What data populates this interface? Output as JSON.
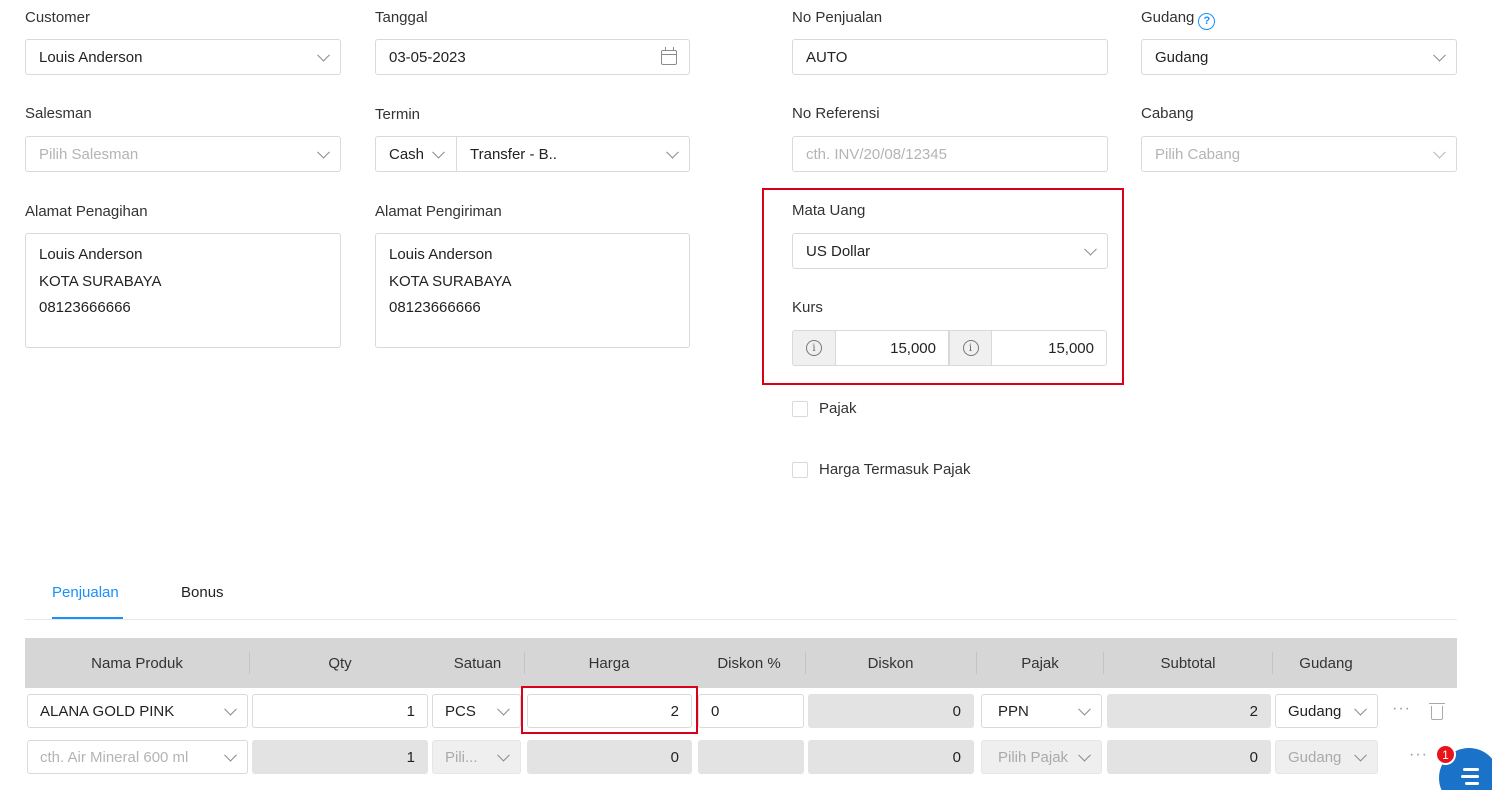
{
  "form": {
    "customer": {
      "label": "Customer",
      "value": "Louis Anderson"
    },
    "tanggal": {
      "label": "Tanggal",
      "value": "03-05-2023"
    },
    "no_penjualan": {
      "label": "No Penjualan",
      "value": "AUTO"
    },
    "gudang": {
      "label": "Gudang",
      "value": "Gudang"
    },
    "salesman": {
      "label": "Salesman",
      "placeholder": "Pilih Salesman"
    },
    "termin": {
      "label": "Termin",
      "type_value": "Cash",
      "method_value": "Transfer - B.."
    },
    "no_referensi": {
      "label": "No Referensi",
      "placeholder": "cth. INV/20/08/12345"
    },
    "cabang": {
      "label": "Cabang",
      "placeholder": "Pilih Cabang"
    },
    "alamat_penagihan": {
      "label": "Alamat Penagihan",
      "lines": [
        "Louis Anderson",
        "KOTA SURABAYA",
        "08123666666"
      ]
    },
    "alamat_pengiriman": {
      "label": "Alamat Pengiriman",
      "lines": [
        "Louis Anderson",
        "KOTA SURABAYA",
        "08123666666"
      ]
    },
    "mata_uang": {
      "label": "Mata Uang",
      "value": "US Dollar"
    },
    "kurs": {
      "label": "Kurs",
      "value1": "15,000",
      "value2": "15,000"
    },
    "pajak": {
      "label": "Pajak"
    },
    "harga_termasuk_pajak": {
      "label": "Harga Termasuk Pajak"
    }
  },
  "tabs": [
    {
      "label": "Penjualan",
      "active": true
    },
    {
      "label": "Bonus",
      "active": false
    }
  ],
  "table": {
    "headers": [
      "Nama Produk",
      "Qty",
      "Satuan",
      "Harga",
      "Diskon %",
      "Diskon",
      "Pajak",
      "Subtotal",
      "Gudang"
    ],
    "row1": {
      "produk": "ALANA GOLD PINK",
      "qty": "1",
      "satuan": "PCS",
      "harga": "2",
      "diskon_pct": "0",
      "diskon": "0",
      "pajak": "PPN",
      "subtotal": "2",
      "gudang": "Gudang"
    },
    "row2": {
      "produk_placeholder": "cth. Air Mineral 600 ml",
      "qty": "1",
      "satuan_placeholder": "Pili...",
      "harga": "0",
      "diskon": "0",
      "pajak_placeholder": "Pilih Pajak",
      "subtotal": "0",
      "gudang": "Gudang"
    }
  },
  "fab": {
    "badge": "1"
  },
  "colors": {
    "accent": "#1890ff",
    "highlight": "#d9001b",
    "fab": "#1a73c9",
    "badge": "#e8141b"
  }
}
